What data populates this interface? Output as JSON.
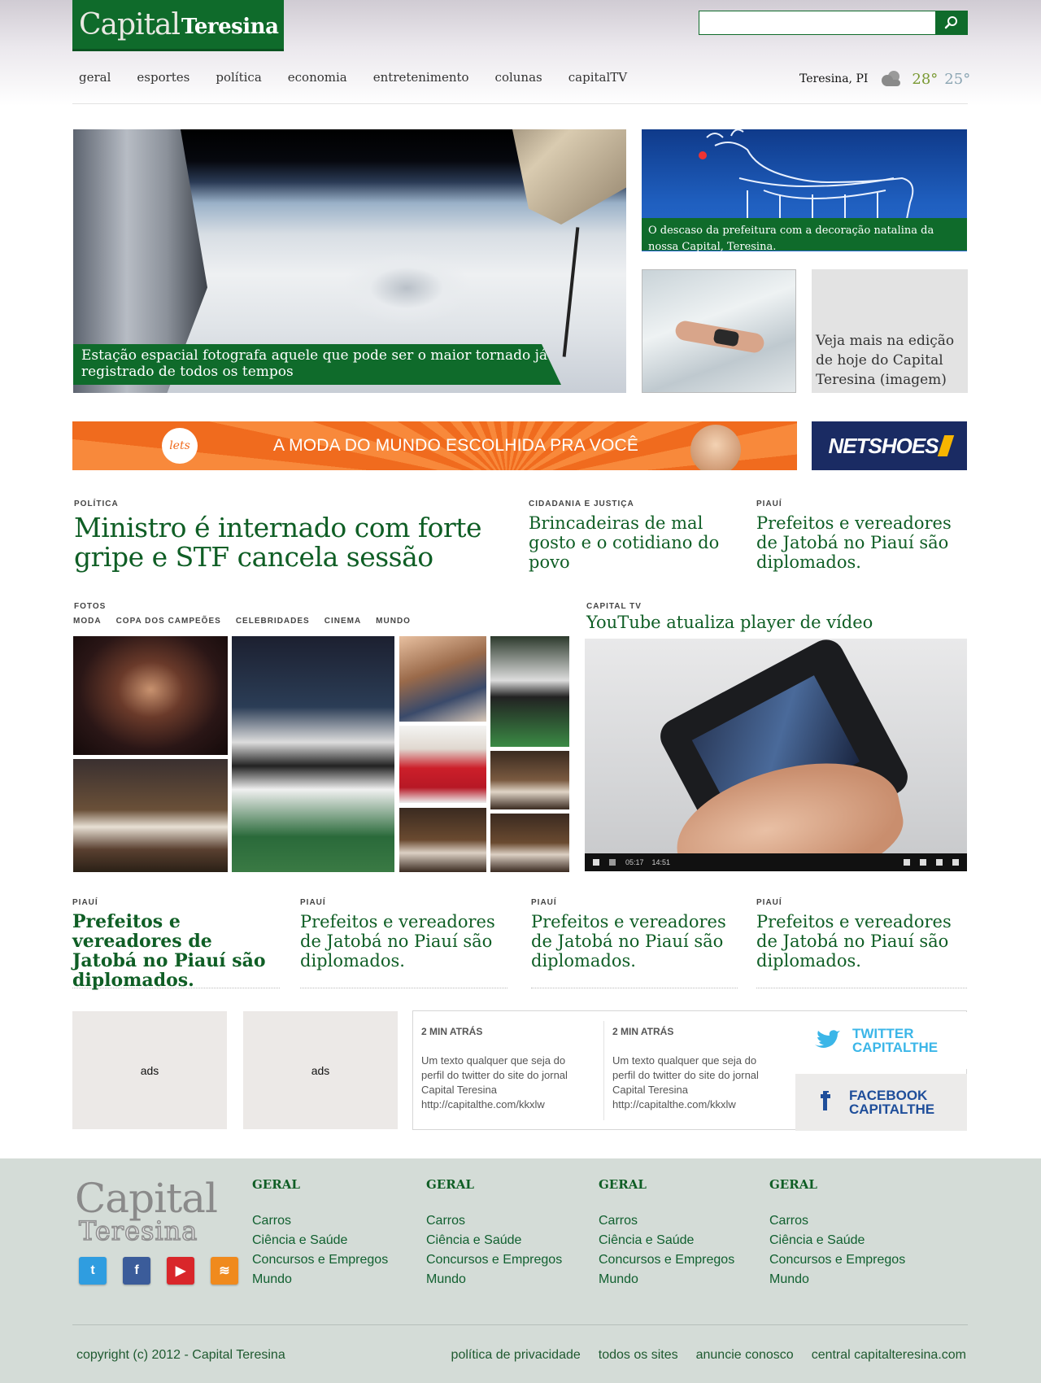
{
  "header": {
    "logo_part1": "Capital",
    "logo_part2": "Teresina",
    "search_placeholder": "",
    "nav": [
      "geral",
      "esportes",
      "política",
      "economia",
      "entretenimento",
      "colunas",
      "capitalTV"
    ],
    "weather": {
      "city": "Teresina, PI",
      "temp_max": "28°",
      "temp_min": "25°",
      "icon": "cloud-icon"
    }
  },
  "hero": {
    "main_caption": "Estação espacial fotografa aquele que pode ser o maior tornado já registrado de todos os tempos",
    "side_caption": "O descaso da prefeitura com a decoração natalina da nossa Capital, Teresina.",
    "side_text": "Veja mais na edição de hoje do Capital Teresina (imagem)"
  },
  "banners": {
    "lets_logo": "lets",
    "ad_text": "A MODA DO MUNDO ESCOLHIDA PRA VOCÊ",
    "netshoes": "NETSHOES"
  },
  "headlines": [
    {
      "kicker": "POLÍTICA",
      "title": "Ministro é internado com forte gripe e STF cancela sessão"
    },
    {
      "kicker": "CIDADANIA E JUSTIÇA",
      "title": "Brincadeiras de mal gosto e o cotidiano do povo"
    },
    {
      "kicker": "PIAUÍ",
      "title": "Prefeitos e vereadores de Jatobá no Piauí são diplomados."
    }
  ],
  "fotos": {
    "kicker": "FOTOS",
    "tabs": [
      "MODA",
      "COPA DOS CAMPEÕES",
      "CELEBRIDADES",
      "CINEMA",
      "MUNDO"
    ]
  },
  "capital_tv": {
    "kicker": "CAPITAL TV",
    "title": "YouTube atualiza player de vídeo",
    "time_current": "05:17",
    "time_total": "14:51"
  },
  "bottom_news": [
    {
      "kicker": "PIAUÍ",
      "title": "Prefeitos e vereadores de Jatobá no Piauí são diplomados."
    },
    {
      "kicker": "PIAUÍ",
      "title": "Prefeitos e vereadores de Jatobá no Piauí são diplomados."
    },
    {
      "kicker": "PIAUÍ",
      "title": "Prefeitos e vereadores de Jatobá no Piauí são diplomados."
    },
    {
      "kicker": "PIAUÍ",
      "title": "Prefeitos e vereadores de Jatobá no Piauí são diplomados."
    }
  ],
  "ads": [
    "ads",
    "ads"
  ],
  "tweets": [
    {
      "time": "2 MIN ATRÁS",
      "text": "Um texto qualquer que seja do perfil do twitter do site do jornal Capital Teresina http://capitalthe.com/kkxlw"
    },
    {
      "time": "2 MIN ATRÁS",
      "text": "Um texto qualquer que seja do perfil do twitter do site do jornal Capital Teresina http://capitalthe.com/kkxlw"
    }
  ],
  "social": {
    "twitter": [
      "TWITTER",
      "CAPITALTHE"
    ],
    "facebook": [
      "FACEBOOK",
      "CAPITALTHE"
    ],
    "colors": {
      "twitter": "#3bb6e8",
      "facebook": "#1f4e9a"
    }
  },
  "footer": {
    "logo_part1": "Capital",
    "logo_part2": "Teresina",
    "columns": [
      {
        "heading": "GERAL",
        "links": [
          "Carros",
          "Ciência e Saúde",
          "Concursos e Empregos",
          "Mundo"
        ]
      },
      {
        "heading": "GERAL",
        "links": [
          "Carros",
          "Ciência e Saúde",
          "Concursos e Empregos",
          "Mundo"
        ]
      },
      {
        "heading": "GERAL",
        "links": [
          "Carros",
          "Ciência e Saúde",
          "Concursos e Empregos",
          "Mundo"
        ]
      },
      {
        "heading": "GERAL",
        "links": [
          "Carros",
          "Ciência e Saúde",
          "Concursos e Empregos",
          "Mundo"
        ]
      }
    ],
    "copyright": "copyright (c) 2012 - Capital Teresina",
    "links": [
      "política de privacidade",
      "todos os sites",
      "anuncie conosco",
      "central capitalteresina.com"
    ]
  },
  "colors": {
    "brand_green": "#0f6b2b",
    "headline_green": "#0f5e25",
    "footer_bg": "#d4dcd7"
  }
}
